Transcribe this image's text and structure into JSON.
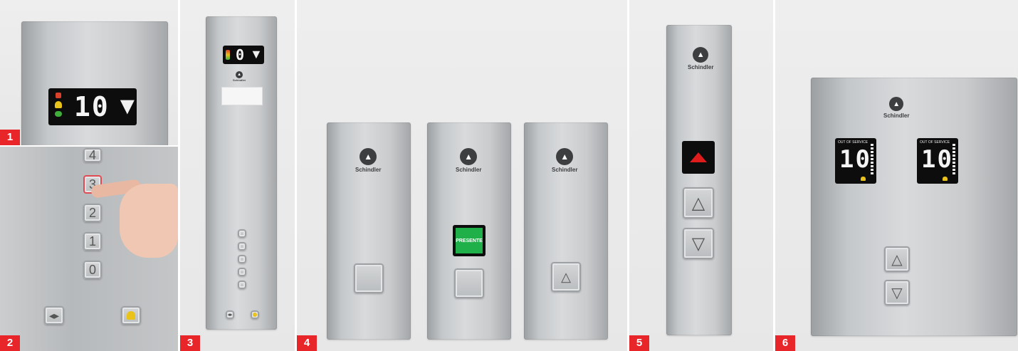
{
  "badges": [
    "1",
    "2",
    "3",
    "4",
    "5",
    "6"
  ],
  "panel1": {
    "display_text": "10",
    "arrow": "▼"
  },
  "panel2": {
    "floor_buttons": [
      "4",
      "3",
      "2",
      "1",
      "0"
    ],
    "door_icon": "◂▸",
    "alarm_icon": "bell-icon"
  },
  "panel3": {
    "display_text": "0",
    "arrow": "▼",
    "logo": "Schindler"
  },
  "panel4": {
    "logo": "Schindler",
    "lit_button_text": "PRESENTE",
    "up_arrow": "△"
  },
  "panel5": {
    "logo": "Schindler",
    "up_arrow": "△",
    "down_arrow": "▽"
  },
  "panel6": {
    "logo": "Schindler",
    "status_text": "OUT OF SERVICE",
    "display_text": "10",
    "up_arrow": "△",
    "down_arrow": "▽"
  },
  "colors": {
    "badge": "#e8262a",
    "display_bg": "#0d0d0d",
    "lit_green": "#1fb04a",
    "arrow_red": "#e01b1b"
  }
}
